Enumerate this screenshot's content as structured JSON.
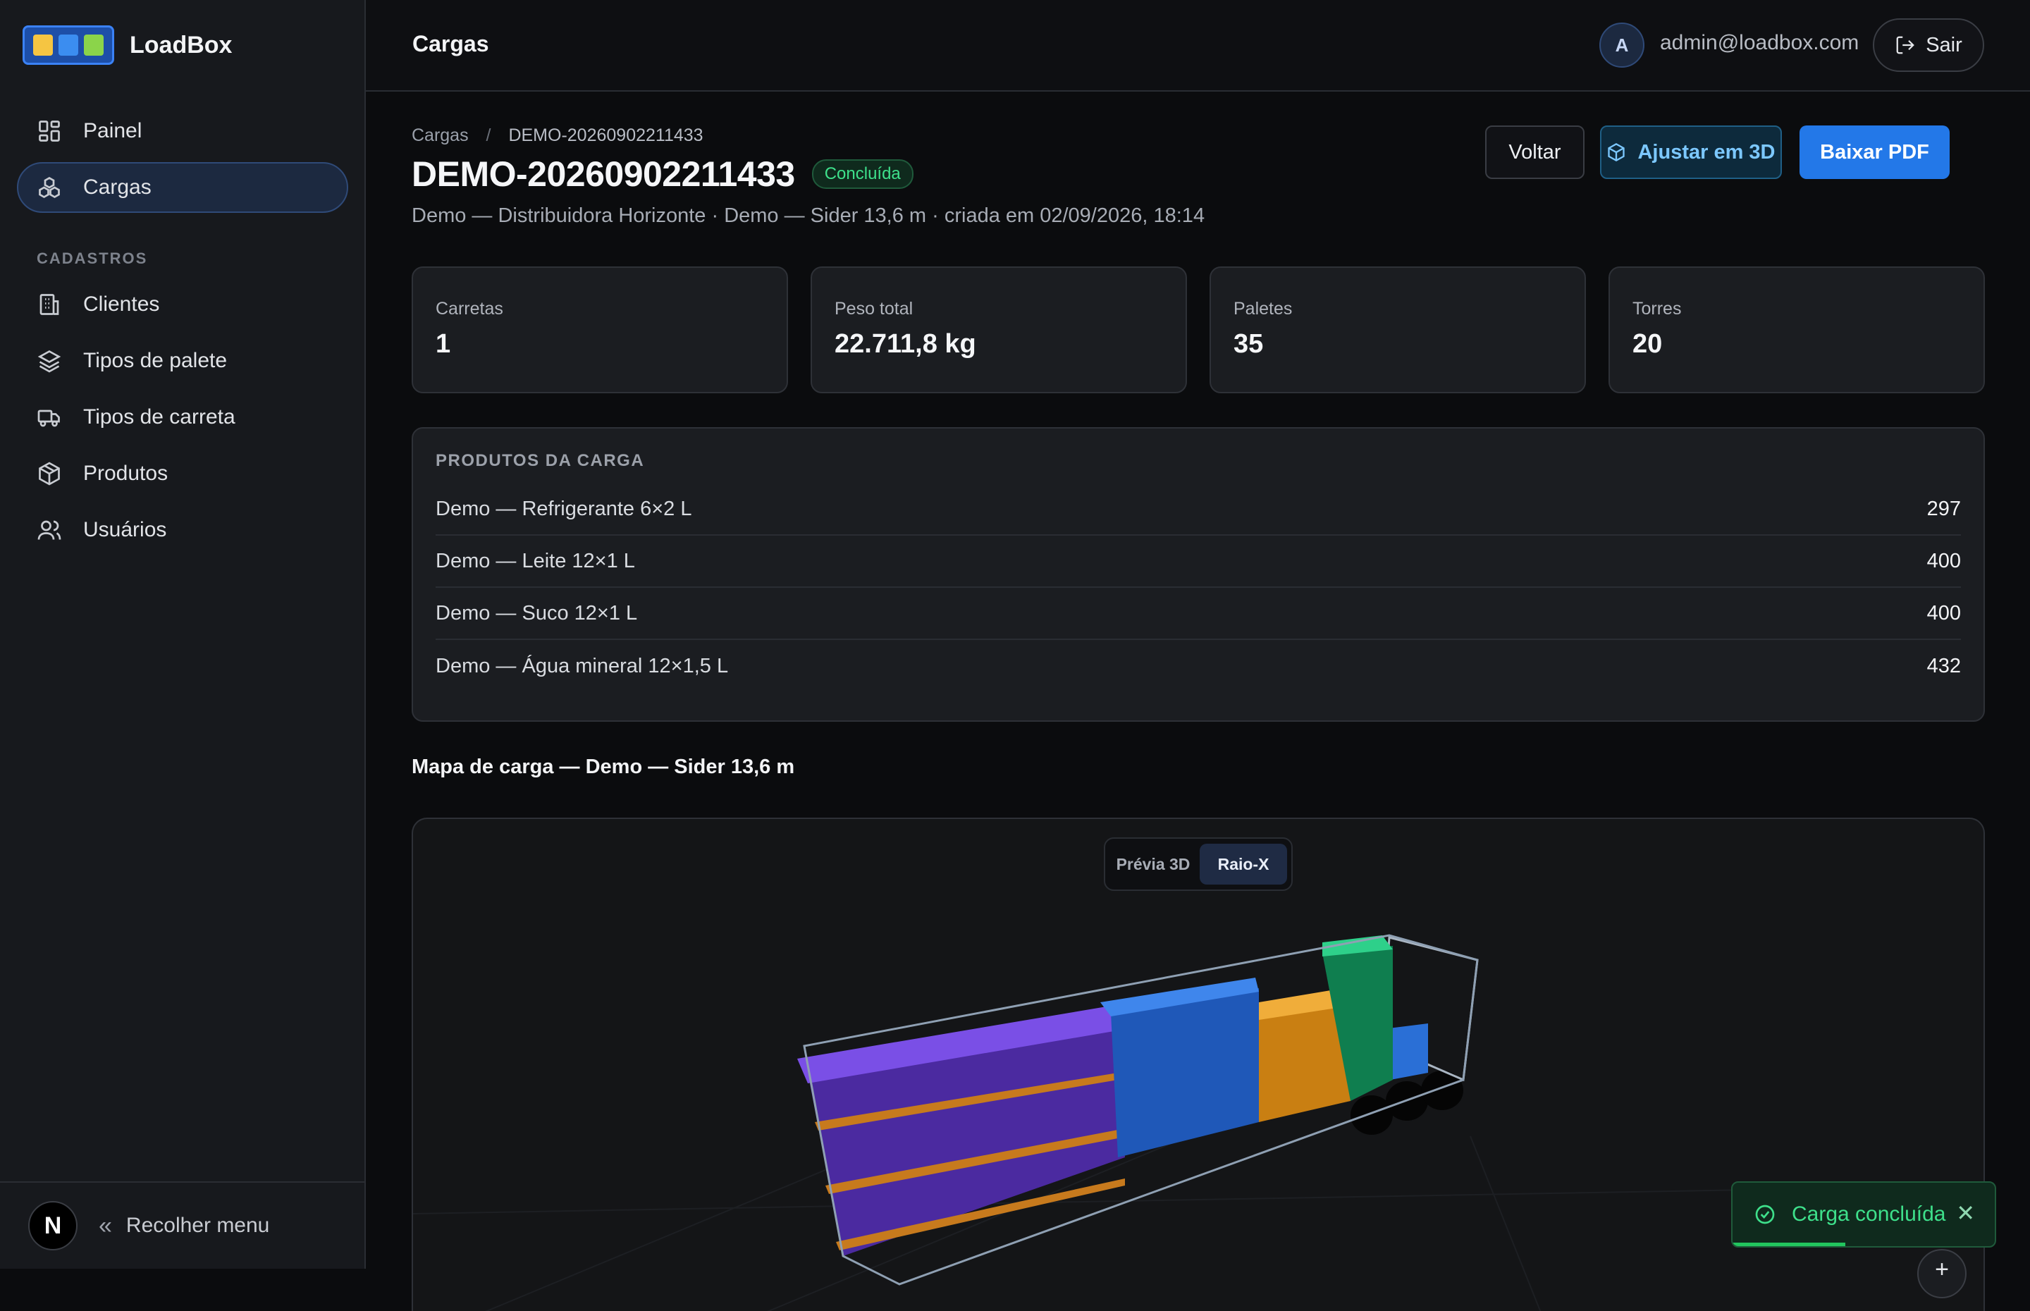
{
  "app": {
    "name": "LoadBox"
  },
  "colors": {
    "accent": "#2378e8",
    "success": "#3ee08b",
    "sidebar_active": "#1c2940",
    "pallet_purple": "#6a3fd1",
    "pallet_blue": "#2a6fd6",
    "pallet_orange": "#e09a22",
    "pallet_green": "#18a86a"
  },
  "sidebar": {
    "nav": [
      {
        "label": "Painel",
        "icon": "dashboard-icon"
      },
      {
        "label": "Cargas",
        "icon": "boxes-icon",
        "active": true
      }
    ],
    "section_label": "CADASTROS",
    "registry": [
      {
        "label": "Clientes",
        "icon": "building-icon"
      },
      {
        "label": "Tipos de palete",
        "icon": "layers-icon"
      },
      {
        "label": "Tipos de carreta",
        "icon": "truck-icon"
      },
      {
        "label": "Produtos",
        "icon": "package-icon"
      },
      {
        "label": "Usuários",
        "icon": "users-icon"
      }
    ],
    "footer": {
      "badge": "N",
      "collapse_label": "Recolher menu"
    }
  },
  "header": {
    "title": "Cargas",
    "user": {
      "initial": "A",
      "email": "admin@loadbox.com"
    },
    "logout_label": "Sair"
  },
  "page": {
    "breadcrumb": {
      "root": "Cargas",
      "separator": "/",
      "current": "DEMO-20260902211433"
    },
    "title": "DEMO-20260902211433",
    "status": "Concluída",
    "subtitle": "Demo — Distribuidora Horizonte · Demo — Sider 13,6 m · criada em 02/09/2026, 18:14",
    "actions": {
      "back": "Voltar",
      "adjust3d": "Ajustar em 3D",
      "pdf": "Baixar PDF"
    },
    "stats": [
      {
        "label": "Carretas",
        "value": "1"
      },
      {
        "label": "Peso total",
        "value": "22.711,8 kg"
      },
      {
        "label": "Paletes",
        "value": "35"
      },
      {
        "label": "Torres",
        "value": "20"
      }
    ],
    "products": {
      "title": "PRODUTOS DA CARGA",
      "items": [
        {
          "name": "Demo — Refrigerante 6×2 L",
          "qty": "297"
        },
        {
          "name": "Demo — Leite 12×1 L",
          "qty": "400"
        },
        {
          "name": "Demo — Suco 12×1 L",
          "qty": "400"
        },
        {
          "name": "Demo — Água mineral 12×1,5 L",
          "qty": "432"
        }
      ]
    },
    "map": {
      "title": "Mapa de carga — Demo — Sider 13,6 m",
      "view_options": [
        "Prévia 3D",
        "Raio-X"
      ],
      "active_view": "Raio-X"
    }
  },
  "toast": {
    "message": "Carga concluída",
    "close": "✕"
  },
  "zoom": {
    "label": "+"
  }
}
